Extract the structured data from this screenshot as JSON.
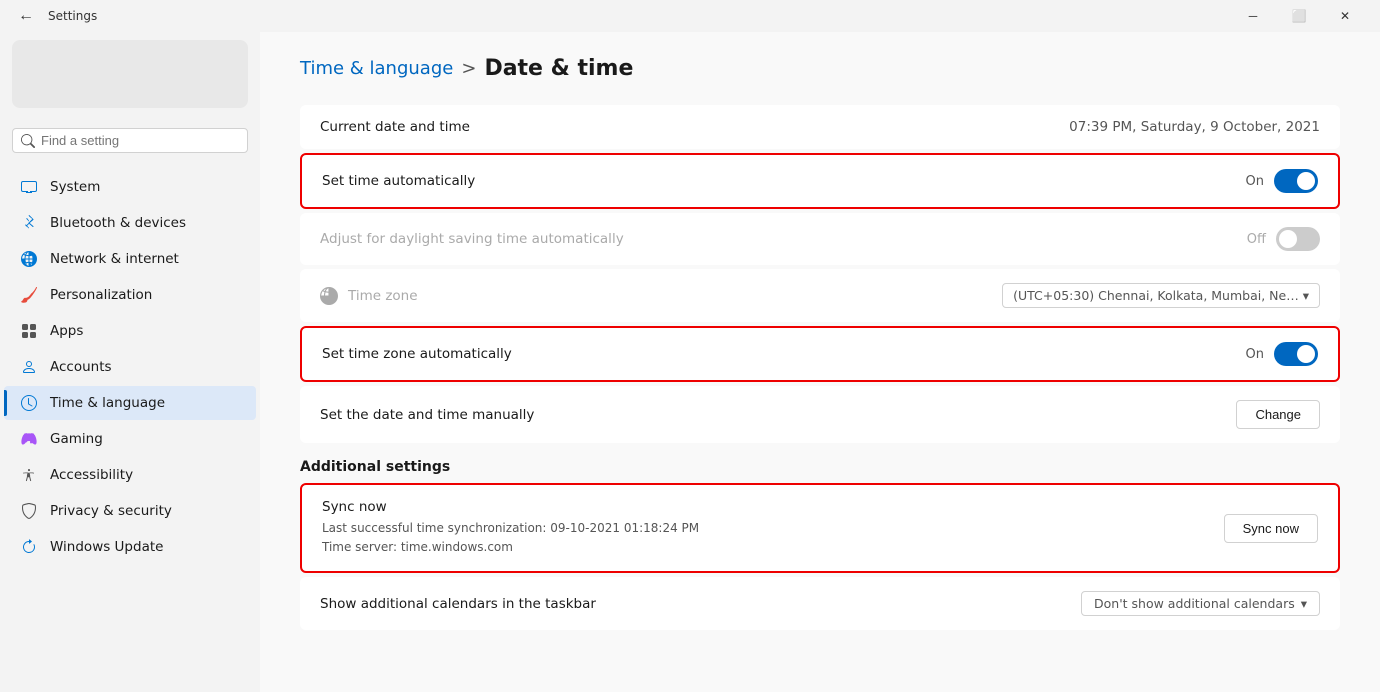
{
  "titlebar": {
    "title": "Settings",
    "minimize_label": "─",
    "restore_label": "⬜",
    "close_label": "✕"
  },
  "sidebar": {
    "search_placeholder": "Find a setting",
    "items": [
      {
        "id": "system",
        "label": "System",
        "icon": "monitor"
      },
      {
        "id": "bluetooth",
        "label": "Bluetooth & devices",
        "icon": "bluetooth"
      },
      {
        "id": "network",
        "label": "Network & internet",
        "icon": "network"
      },
      {
        "id": "personalization",
        "label": "Personalization",
        "icon": "brush"
      },
      {
        "id": "apps",
        "label": "Apps",
        "icon": "apps"
      },
      {
        "id": "accounts",
        "label": "Accounts",
        "icon": "person"
      },
      {
        "id": "time",
        "label": "Time & language",
        "icon": "clock",
        "active": true
      },
      {
        "id": "gaming",
        "label": "Gaming",
        "icon": "gamepad"
      },
      {
        "id": "accessibility",
        "label": "Accessibility",
        "icon": "accessibility"
      },
      {
        "id": "privacy",
        "label": "Privacy & security",
        "icon": "shield"
      },
      {
        "id": "update",
        "label": "Windows Update",
        "icon": "update"
      }
    ]
  },
  "breadcrumb": {
    "parent": "Time & language",
    "separator": ">",
    "current": "Date & time"
  },
  "current_datetime": {
    "label": "Current date and time",
    "value": "07:39 PM, Saturday, 9 October, 2021"
  },
  "set_time_auto": {
    "label": "Set time automatically",
    "state_label": "On",
    "is_on": true,
    "highlighted": true
  },
  "daylight_saving": {
    "label": "Adjust for daylight saving time automatically",
    "state_label": "Off",
    "is_on": false,
    "disabled": true
  },
  "timezone": {
    "label": "Time zone",
    "value": "(UTC+05:30) Chennai, Kolkata, Mumbai, Ne…",
    "disabled": true
  },
  "set_timezone_auto": {
    "label": "Set time zone automatically",
    "state_label": "On",
    "is_on": true,
    "highlighted": true
  },
  "set_date_manual": {
    "label": "Set the date and time manually",
    "button_label": "Change"
  },
  "additional_settings": {
    "header": "Additional settings"
  },
  "sync_now": {
    "title": "Sync now",
    "last_sync": "Last successful time synchronization: 09-10-2021 01:18:24 PM",
    "time_server": "Time server: time.windows.com",
    "button_label": "Sync now",
    "highlighted": true
  },
  "additional_calendars": {
    "label": "Show additional calendars in the taskbar",
    "value": "Don't show additional calendars"
  }
}
